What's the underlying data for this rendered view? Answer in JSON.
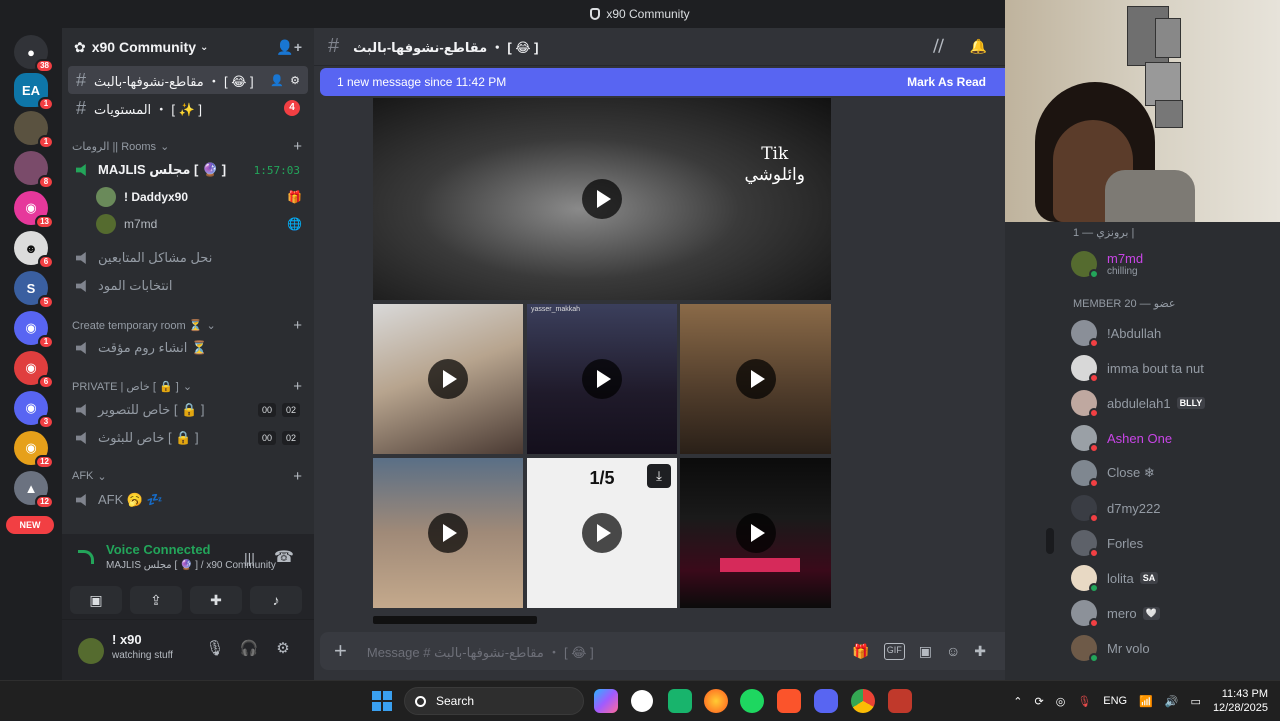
{
  "window": {
    "title": "x90 Community"
  },
  "servers": [
    {
      "badge": "38"
    },
    {
      "badge": "1"
    },
    {
      "badge": "1"
    },
    {
      "badge": "8"
    },
    {
      "badge": "13"
    },
    {
      "badge": "6"
    },
    {
      "badge": "5"
    },
    {
      "badge": "1"
    },
    {
      "badge": "6"
    },
    {
      "badge": "3"
    },
    {
      "badge": "12"
    },
    {
      "badge": "12"
    }
  ],
  "new_label": "NEW",
  "server": {
    "name": "x90 Community"
  },
  "channels": {
    "active": "مقاطع-نشوفها-بالبث ・ [ 😂 ]",
    "levels": "المستويات ・ [ ✨ ]",
    "levels_mentions": "4",
    "rooms_category": "الرومات || Rooms",
    "majlis": "MAJLIS مجلس [ 🔮 ]",
    "majlis_timer": "1:57:03",
    "voice_users": [
      {
        "name": "! Daddyx90"
      },
      {
        "name": "m7md"
      }
    ],
    "support": "نحل مشاكل المتابعين",
    "mod_elections": "انتخابات المود",
    "temp_category": "Create temporary room ⏳",
    "temp_create": "انشاء روم مؤقت ⏳",
    "private_category": "PRIVATE | خاص [ 🔒 ]",
    "private_record": "خاص للتصوير [ 🔒 ]",
    "private_stream": "خاص للبثوث [ 🔒 ]",
    "private_counts": [
      "00",
      "02"
    ],
    "afk_category": "AFK",
    "afk_channel": "AFK 🥱 💤"
  },
  "voice": {
    "status": "Voice Connected",
    "location": "MAJLIS مجلس [ 🔮 ] / x90 Community"
  },
  "user": {
    "name": "! x90",
    "status": "watching stuff"
  },
  "chat": {
    "channel_title": "مقاطع-نشوفها-بالبث ・ [ 😂 ]",
    "new_messages": "1 new message since 11:42 PM",
    "mark_as_read": "Mark As Read",
    "composer_placeholder": "Message # مقاطع-نشوفها-بالبث ・ [ 😂 ]",
    "video_caption_1": "Tik",
    "video_caption_2": "وائلوشي",
    "video_chip": "yasser_makkah",
    "slide_counter": "1/5"
  },
  "members": {
    "top_group": "برونزي — 1 |",
    "top_user": "m7md",
    "top_user_status": "chilling",
    "member_group": "MEMBER 20 — عضو",
    "list": [
      {
        "name": "!Abdullah",
        "tag": ""
      },
      {
        "name": "imma bout ta nut",
        "tag": ""
      },
      {
        "name": "abdulelah1",
        "tag": "BLLY"
      },
      {
        "name": "Ashen One",
        "tag": ""
      },
      {
        "name": "Close ❄",
        "tag": ""
      },
      {
        "name": "d7my222",
        "tag": ""
      },
      {
        "name": "Forles",
        "tag": ""
      },
      {
        "name": "lolita",
        "tag": "SA"
      },
      {
        "name": "mero",
        "tag": "🤍"
      },
      {
        "name": "Mr volo",
        "tag": ""
      }
    ]
  },
  "taskbar": {
    "search": "Search",
    "language": "ENG",
    "time": "11:43 PM",
    "date": "12/28/2025"
  }
}
